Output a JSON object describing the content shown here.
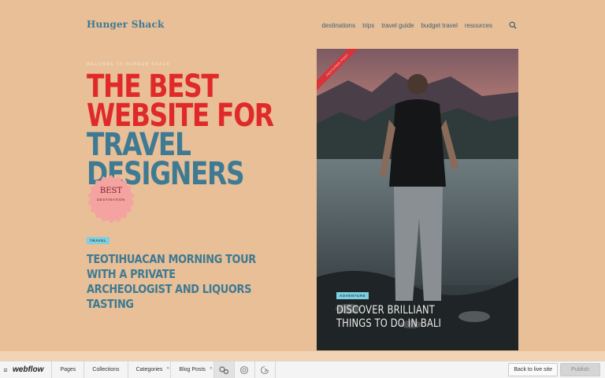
{
  "site": {
    "brand": "Hunger Shack",
    "nav": [
      "destinations",
      "trips",
      "travel guide",
      "budget travel",
      "resources"
    ]
  },
  "hero": {
    "eyebrow": "WELCOME TO HUNGER SHACK",
    "lines": [
      "THE BEST",
      "WEBSITE FOR",
      "TRAVEL",
      "DESIGNERS"
    ],
    "badge_big": "BEST",
    "badge_small": "DESTINATION"
  },
  "story": {
    "tag": "TRAVEL",
    "title": "TEOTIHUACAN MORNING TOUR WITH A PRIVATE ARCHEOLOGIST AND LIQUORS TASTING"
  },
  "card": {
    "ribbon": "FEATURED POST",
    "tag": "ADVENTURE",
    "title": "DISCOVER BRILLIANT THINGS TO DO IN BALI"
  },
  "webflow_bar": {
    "logo": "webflow",
    "tabs": [
      "Pages",
      "Collections",
      "Categories",
      "Blog Posts"
    ],
    "icons": [
      "cms-settings-icon",
      "preview-icon",
      "audit-icon"
    ],
    "back_label": "Back to live site",
    "publish_label": "Publish"
  },
  "colors": {
    "background": "#e8bf97",
    "red": "#e02a2a",
    "teal": "#3e7a93",
    "tag": "#7dd0df",
    "badge": "#f4a3a0"
  }
}
